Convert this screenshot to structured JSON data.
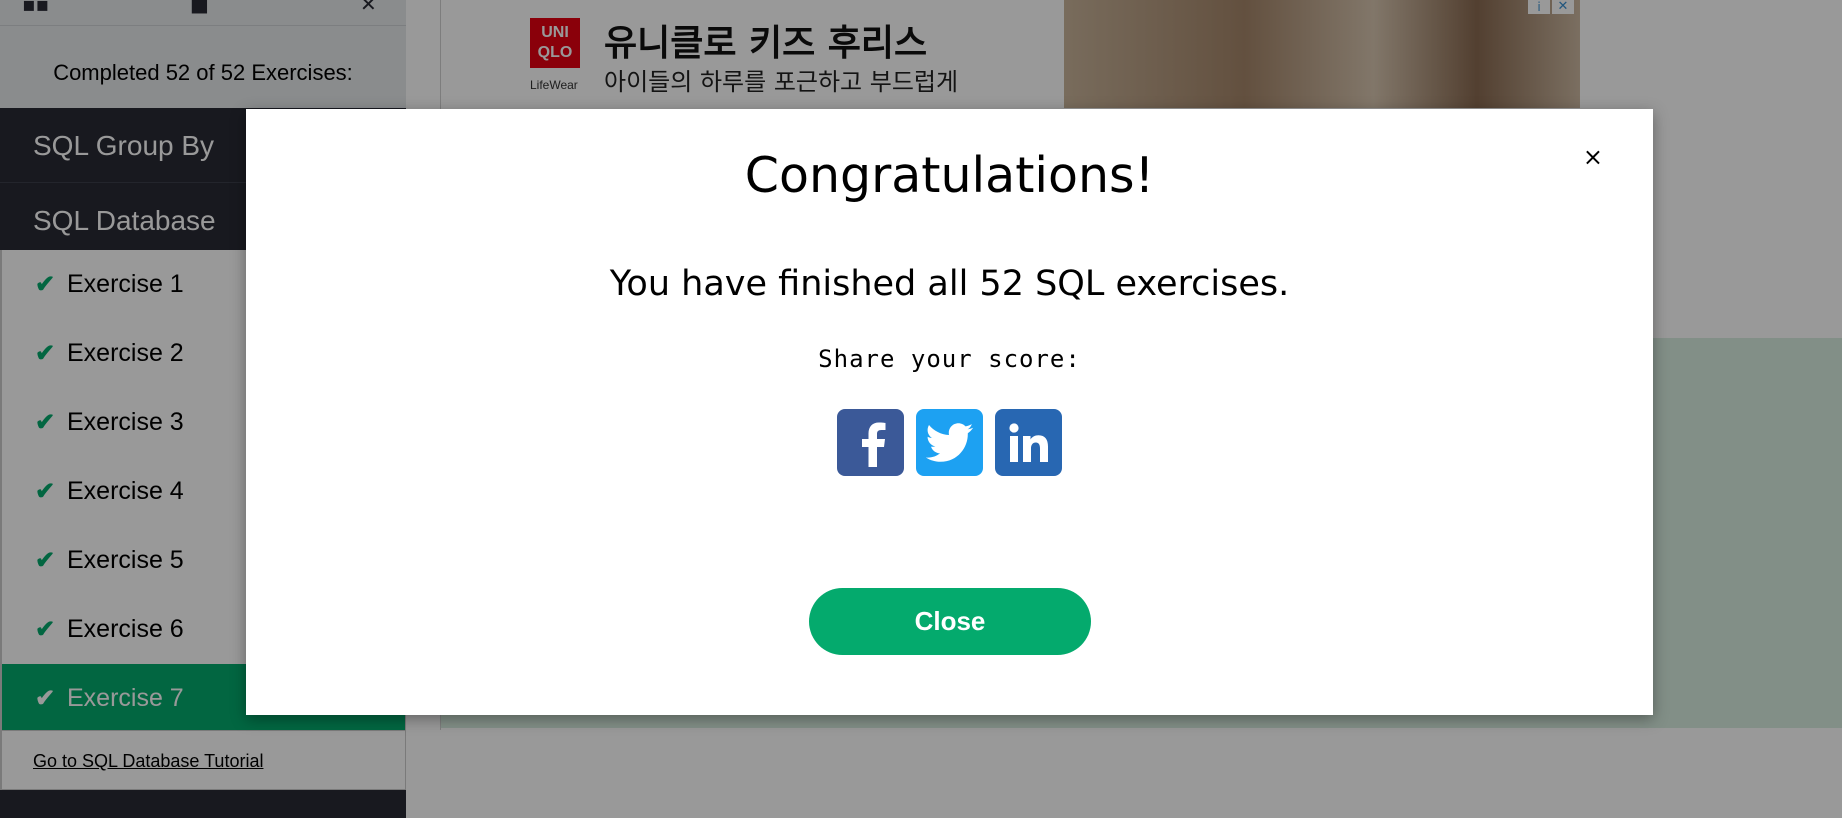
{
  "sidebar": {
    "completed_text": "Completed 52 of 52 Exercises:",
    "sections": [
      {
        "label": "SQL Group By"
      },
      {
        "label": "SQL Database"
      }
    ],
    "exercises": [
      {
        "label": "Exercise 1",
        "done": true,
        "active": false
      },
      {
        "label": "Exercise 2",
        "done": true,
        "active": false
      },
      {
        "label": "Exercise 3",
        "done": true,
        "active": false
      },
      {
        "label": "Exercise 4",
        "done": true,
        "active": false
      },
      {
        "label": "Exercise 5",
        "done": true,
        "active": false
      },
      {
        "label": "Exercise 6",
        "done": true,
        "active": false
      },
      {
        "label": "Exercise 7",
        "done": true,
        "active": true
      }
    ],
    "tutorial_link": "Go to SQL Database Tutorial"
  },
  "ad": {
    "brand_lines": [
      "UNI",
      "QLO"
    ],
    "brand_sub": "LifeWear",
    "headline": "유니클로 키즈 후리스",
    "subline": "아이들의 하루를 포근하고 부드럽게",
    "info_icon": "i",
    "close_icon": "✕"
  },
  "modal": {
    "close_x": "×",
    "title": "Congratulations!",
    "message": "You have finished all 52 SQL exercises.",
    "share_label": "Share your score:",
    "share_buttons": [
      {
        "network": "facebook",
        "icon": "facebook-icon",
        "color": "#3B5998"
      },
      {
        "network": "twitter",
        "icon": "twitter-icon",
        "color": "#1DA1F2"
      },
      {
        "network": "linkedin",
        "icon": "linkedin-icon",
        "color": "#2867B2"
      }
    ],
    "close_label": "Close"
  },
  "colors": {
    "accent_green": "#04AA6D",
    "sidebar_dark": "#282A35",
    "panel_green": "#D9EEE1"
  }
}
